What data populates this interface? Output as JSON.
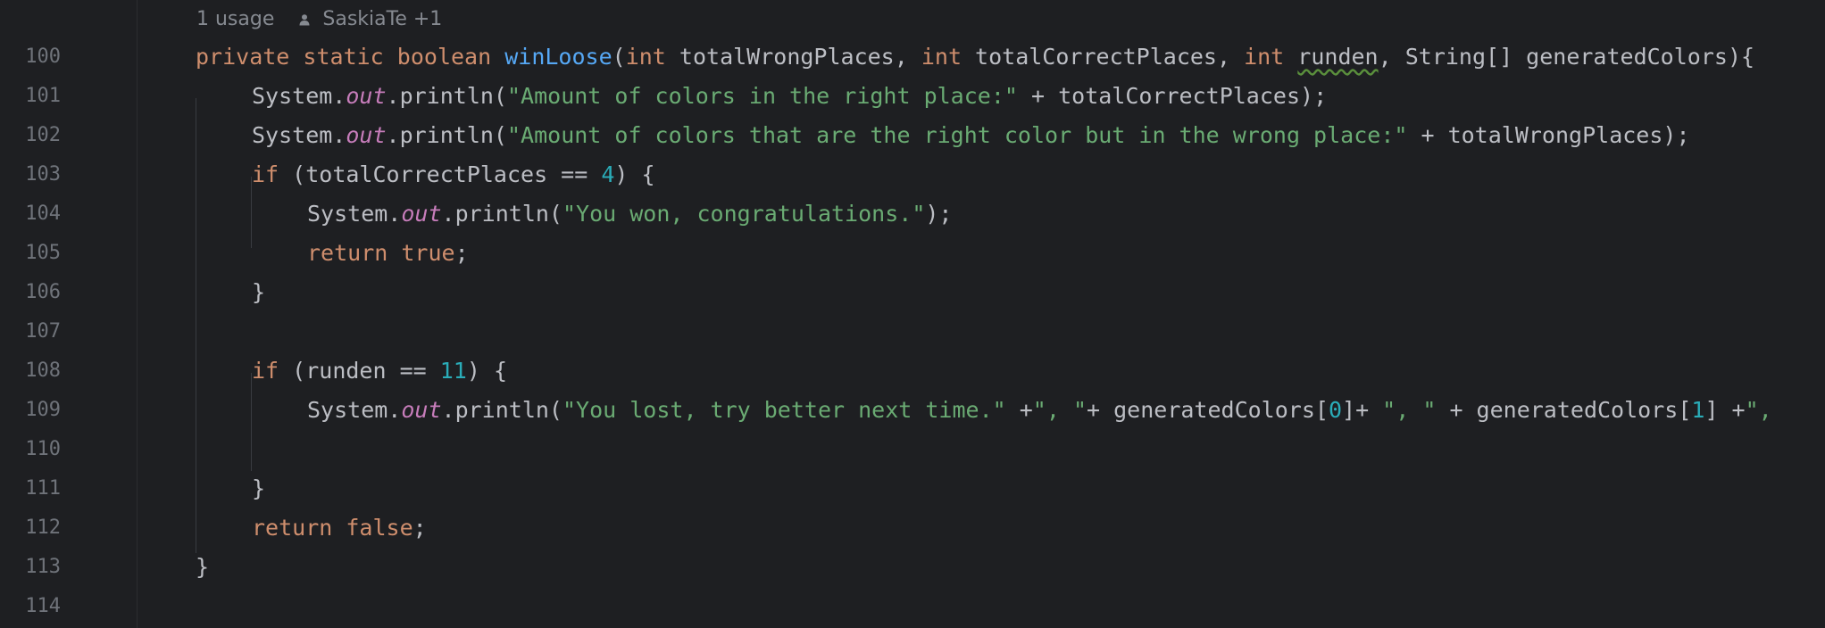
{
  "inlay_hint": {
    "usages": "1 usage",
    "authors": "SaskiaTe +1"
  },
  "line_numbers": [
    "100",
    "101",
    "102",
    "103",
    "104",
    "105",
    "106",
    "107",
    "108",
    "109",
    "110",
    "111",
    "112",
    "113",
    "114"
  ],
  "code": {
    "l100": {
      "private": "private",
      "sp1": " ",
      "static": "static",
      "sp2": " ",
      "boolean": "boolean",
      "sp3": " ",
      "fn": "winLoose",
      "open": "(",
      "int1": "int",
      "p1": " totalWrongPlaces, ",
      "int2": "int",
      "p2": " totalCorrectPlaces, ",
      "int3": "int",
      "sp4": " ",
      "runden": "runden",
      "p3": ", String[] generatedColors){"
    },
    "l101": {
      "a": "System.",
      "out": "out",
      "b": ".println(",
      "s": "\"Amount of colors in the right place:\"",
      "c": " + totalCorrectPlaces);"
    },
    "l102": {
      "a": "System.",
      "out": "out",
      "b": ".println(",
      "s": "\"Amount of colors that are the right color but in the wrong place:\"",
      "c": " + totalWrongPlaces);"
    },
    "l103": {
      "if": "if",
      "a": " (totalCorrectPlaces == ",
      "n": "4",
      "b": ") {"
    },
    "l104": {
      "a": "System.",
      "out": "out",
      "b": ".println(",
      "s": "\"You won, congratulations.\"",
      "c": ");"
    },
    "l105": {
      "ret": "return",
      "sp": " ",
      "val": "true",
      "semi": ";"
    },
    "l106": {
      "a": "}"
    },
    "l108": {
      "if": "if",
      "a": " (runden == ",
      "n": "11",
      "b": ") {"
    },
    "l109": {
      "a": "System.",
      "out": "out",
      "b": ".println(",
      "s1": "\"You lost, try better next time.\"",
      "c1": " +",
      "s2": "\", \"",
      "c2": "+ generatedColors[",
      "n0": "0",
      "c3": "]+ ",
      "s3": "\", \"",
      "c4": " + generatedColors[",
      "n1": "1",
      "c5": "] +",
      "s4": "\","
    },
    "l111": {
      "a": "}"
    },
    "l112": {
      "ret": "return",
      "sp": " ",
      "val": "false",
      "semi": ";"
    },
    "l113": {
      "a": "}"
    }
  },
  "colors": {
    "background": "#1e1f22",
    "keyword": "#cf8e6d",
    "function": "#56a8f5",
    "string": "#6aab73",
    "number": "#2aacb8",
    "static_field": "#c77dbb",
    "text": "#bcbec4",
    "line_number": "#6f737a"
  }
}
